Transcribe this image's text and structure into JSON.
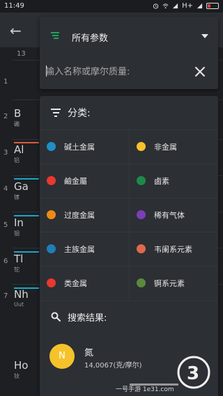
{
  "status_bar": {
    "time": "11:49",
    "network": "H+"
  },
  "background": {
    "column_number": "13",
    "rows": [
      {
        "row": "1",
        "symbol": "",
        "name": "",
        "bar_color": ""
      },
      {
        "row": "2",
        "symbol": "B",
        "name": "硼",
        "bar_color": "#e05a3a"
      },
      {
        "row": "3",
        "symbol": "Al",
        "name": "铝",
        "bar_color": "#1aa7c8"
      },
      {
        "row": "4",
        "symbol": "Ga",
        "name": "镓",
        "bar_color": "#1aa7c8"
      },
      {
        "row": "5",
        "symbol": "In",
        "name": "铟",
        "bar_color": "#1aa7c8"
      },
      {
        "row": "6",
        "symbol": "Tl",
        "name": "铊",
        "bar_color": "#1aa7c8"
      },
      {
        "row": "7",
        "symbol": "Nh",
        "name": "Uut",
        "bar_color": ""
      },
      {
        "row": "",
        "symbol": "Ho",
        "name": "钬",
        "bar_color": ""
      }
    ]
  },
  "selector": {
    "label": "所有参数",
    "icon": "sort-icon"
  },
  "search": {
    "placeholder": "输入名称或摩尔质量:"
  },
  "categories": {
    "title": "分类:",
    "items": [
      {
        "label": "碱土金属",
        "color": "#1f8fc4"
      },
      {
        "label": "非金属",
        "color": "#f5c22b"
      },
      {
        "label": "鹼金屬",
        "color": "#e8382f"
      },
      {
        "label": "鹵素",
        "color": "#1d8a4b"
      },
      {
        "label": "过度金属",
        "color": "#ef8a15"
      },
      {
        "label": "稀有气体",
        "color": "#7a3fb5"
      },
      {
        "label": "主族金属",
        "color": "#1e7fb8"
      },
      {
        "label": "韦阑系元素",
        "color": "#e0694c"
      },
      {
        "label": "类金属",
        "color": "#e8382f"
      },
      {
        "label": "锕系元素",
        "color": "#5a8a3c"
      }
    ]
  },
  "results": {
    "title": "搜索结果:",
    "items": [
      {
        "symbol": "N",
        "name": "氮",
        "mass": "14,0067(克/摩尔)",
        "color": "#f5c22b"
      }
    ]
  },
  "watermark": {
    "text": "一号手游 1e31.com"
  }
}
